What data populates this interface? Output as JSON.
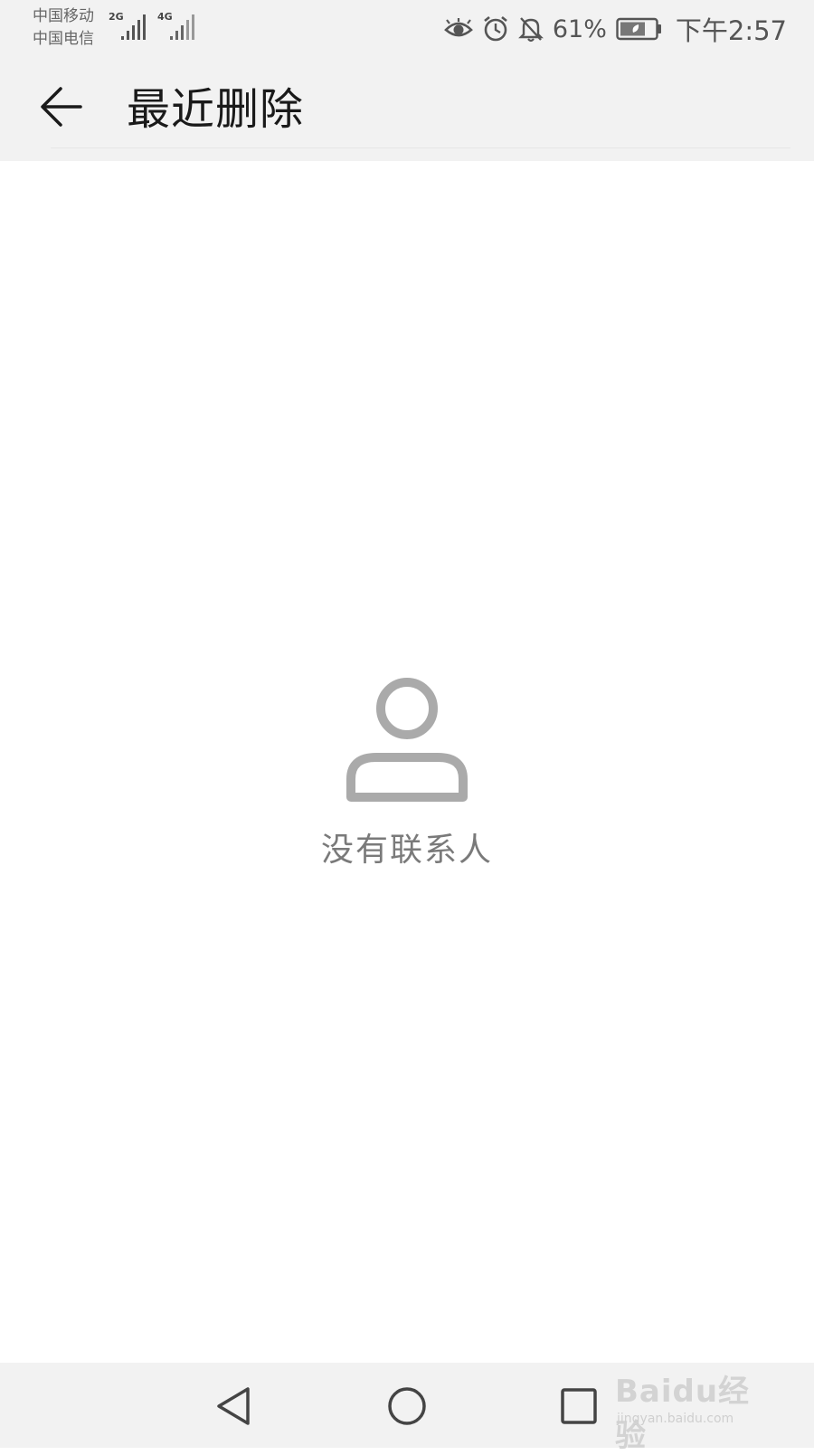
{
  "status_bar": {
    "carrier_1": "中国移动",
    "carrier_2": "中国电信",
    "network_1": "2G",
    "network_2": "4G",
    "battery_percent": "61%",
    "time": "下午2:57",
    "icons": [
      "eye-icon",
      "alarm-icon",
      "mute-bell-icon",
      "battery-icon"
    ]
  },
  "app_bar": {
    "title": "最近删除",
    "back_icon": "arrow-left-icon"
  },
  "empty_state": {
    "icon": "person-icon",
    "message": "没有联系人"
  },
  "nav_bar": {
    "icons": [
      "triangle-back-icon",
      "circle-home-icon",
      "square-recents-icon"
    ]
  },
  "watermark": {
    "logo": "Baidu经验",
    "url": "jingyan.baidu.com"
  },
  "colors": {
    "bar_background": "#f2f2f2",
    "content_background": "#ffffff",
    "title_text": "#1a1a1a",
    "empty_icon": "#aaaaaa",
    "empty_text": "#7a7a7a"
  }
}
